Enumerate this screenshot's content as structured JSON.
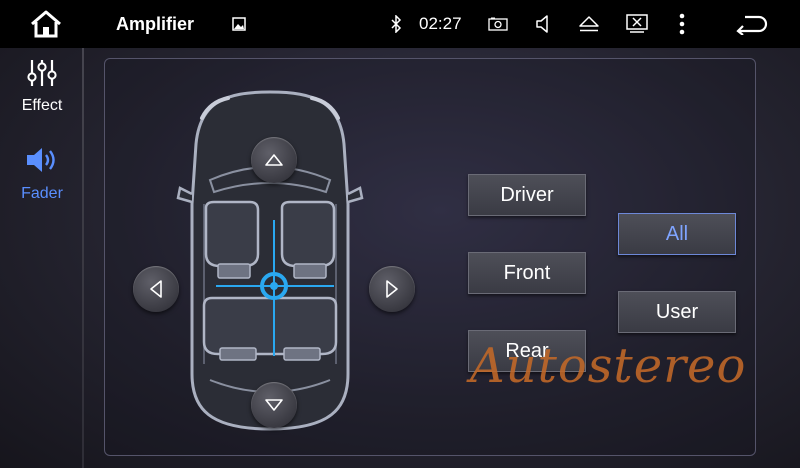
{
  "header": {
    "title": "Amplifier",
    "time": "02:27",
    "icons": [
      "home-icon",
      "gallery-icon",
      "bluetooth-icon",
      "camera-icon",
      "volume-icon",
      "eject-icon",
      "screen-off-icon",
      "more-icon",
      "back-icon"
    ]
  },
  "sidebar": {
    "items": [
      {
        "label": "Effect",
        "icon": "equalizer-icon"
      },
      {
        "label": "Fader",
        "icon": "speaker-icon",
        "selected": true
      }
    ]
  },
  "fader": {
    "buttons": {
      "driver": "Driver",
      "front": "Front",
      "rear": "Rear",
      "all": "All",
      "user": "User"
    },
    "selected": "All"
  },
  "watermark": "Autostereo",
  "colors": {
    "accent": "#5a8fff",
    "crosshair": "#2aa8f0",
    "watermark": "#c36928"
  }
}
